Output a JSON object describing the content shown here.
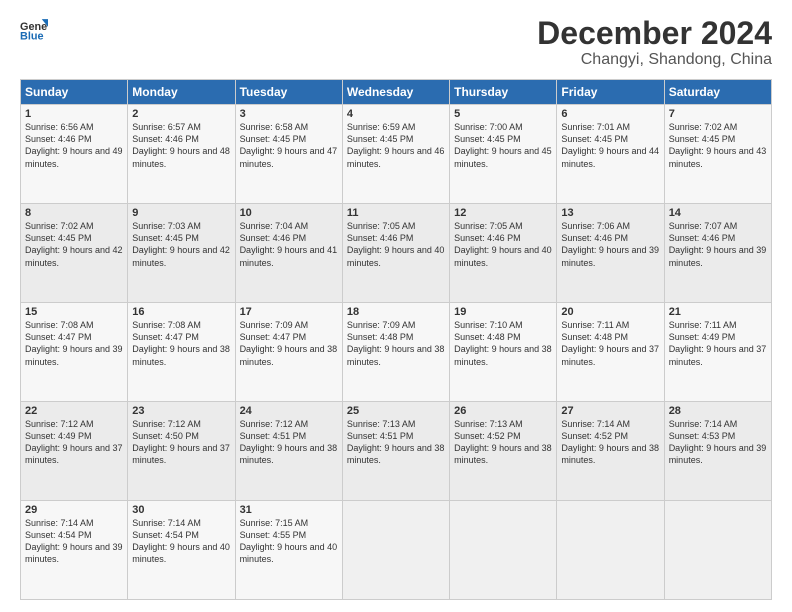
{
  "header": {
    "logo_line1": "General",
    "logo_line2": "Blue",
    "title": "December 2024",
    "subtitle": "Changyi, Shandong, China"
  },
  "days_of_week": [
    "Sunday",
    "Monday",
    "Tuesday",
    "Wednesday",
    "Thursday",
    "Friday",
    "Saturday"
  ],
  "weeks": [
    [
      {
        "day": "1",
        "sunrise": "6:56 AM",
        "sunset": "4:46 PM",
        "daylight": "9 hours and 49 minutes."
      },
      {
        "day": "2",
        "sunrise": "6:57 AM",
        "sunset": "4:46 PM",
        "daylight": "9 hours and 48 minutes."
      },
      {
        "day": "3",
        "sunrise": "6:58 AM",
        "sunset": "4:45 PM",
        "daylight": "9 hours and 47 minutes."
      },
      {
        "day": "4",
        "sunrise": "6:59 AM",
        "sunset": "4:45 PM",
        "daylight": "9 hours and 46 minutes."
      },
      {
        "day": "5",
        "sunrise": "7:00 AM",
        "sunset": "4:45 PM",
        "daylight": "9 hours and 45 minutes."
      },
      {
        "day": "6",
        "sunrise": "7:01 AM",
        "sunset": "4:45 PM",
        "daylight": "9 hours and 44 minutes."
      },
      {
        "day": "7",
        "sunrise": "7:02 AM",
        "sunset": "4:45 PM",
        "daylight": "9 hours and 43 minutes."
      }
    ],
    [
      {
        "day": "8",
        "sunrise": "7:02 AM",
        "sunset": "4:45 PM",
        "daylight": "9 hours and 42 minutes."
      },
      {
        "day": "9",
        "sunrise": "7:03 AM",
        "sunset": "4:45 PM",
        "daylight": "9 hours and 42 minutes."
      },
      {
        "day": "10",
        "sunrise": "7:04 AM",
        "sunset": "4:46 PM",
        "daylight": "9 hours and 41 minutes."
      },
      {
        "day": "11",
        "sunrise": "7:05 AM",
        "sunset": "4:46 PM",
        "daylight": "9 hours and 40 minutes."
      },
      {
        "day": "12",
        "sunrise": "7:05 AM",
        "sunset": "4:46 PM",
        "daylight": "9 hours and 40 minutes."
      },
      {
        "day": "13",
        "sunrise": "7:06 AM",
        "sunset": "4:46 PM",
        "daylight": "9 hours and 39 minutes."
      },
      {
        "day": "14",
        "sunrise": "7:07 AM",
        "sunset": "4:46 PM",
        "daylight": "9 hours and 39 minutes."
      }
    ],
    [
      {
        "day": "15",
        "sunrise": "7:08 AM",
        "sunset": "4:47 PM",
        "daylight": "9 hours and 39 minutes."
      },
      {
        "day": "16",
        "sunrise": "7:08 AM",
        "sunset": "4:47 PM",
        "daylight": "9 hours and 38 minutes."
      },
      {
        "day": "17",
        "sunrise": "7:09 AM",
        "sunset": "4:47 PM",
        "daylight": "9 hours and 38 minutes."
      },
      {
        "day": "18",
        "sunrise": "7:09 AM",
        "sunset": "4:48 PM",
        "daylight": "9 hours and 38 minutes."
      },
      {
        "day": "19",
        "sunrise": "7:10 AM",
        "sunset": "4:48 PM",
        "daylight": "9 hours and 38 minutes."
      },
      {
        "day": "20",
        "sunrise": "7:11 AM",
        "sunset": "4:48 PM",
        "daylight": "9 hours and 37 minutes."
      },
      {
        "day": "21",
        "sunrise": "7:11 AM",
        "sunset": "4:49 PM",
        "daylight": "9 hours and 37 minutes."
      }
    ],
    [
      {
        "day": "22",
        "sunrise": "7:12 AM",
        "sunset": "4:49 PM",
        "daylight": "9 hours and 37 minutes."
      },
      {
        "day": "23",
        "sunrise": "7:12 AM",
        "sunset": "4:50 PM",
        "daylight": "9 hours and 37 minutes."
      },
      {
        "day": "24",
        "sunrise": "7:12 AM",
        "sunset": "4:51 PM",
        "daylight": "9 hours and 38 minutes."
      },
      {
        "day": "25",
        "sunrise": "7:13 AM",
        "sunset": "4:51 PM",
        "daylight": "9 hours and 38 minutes."
      },
      {
        "day": "26",
        "sunrise": "7:13 AM",
        "sunset": "4:52 PM",
        "daylight": "9 hours and 38 minutes."
      },
      {
        "day": "27",
        "sunrise": "7:14 AM",
        "sunset": "4:52 PM",
        "daylight": "9 hours and 38 minutes."
      },
      {
        "day": "28",
        "sunrise": "7:14 AM",
        "sunset": "4:53 PM",
        "daylight": "9 hours and 39 minutes."
      }
    ],
    [
      {
        "day": "29",
        "sunrise": "7:14 AM",
        "sunset": "4:54 PM",
        "daylight": "9 hours and 39 minutes."
      },
      {
        "day": "30",
        "sunrise": "7:14 AM",
        "sunset": "4:54 PM",
        "daylight": "9 hours and 40 minutes."
      },
      {
        "day": "31",
        "sunrise": "7:15 AM",
        "sunset": "4:55 PM",
        "daylight": "9 hours and 40 minutes."
      },
      null,
      null,
      null,
      null
    ]
  ]
}
